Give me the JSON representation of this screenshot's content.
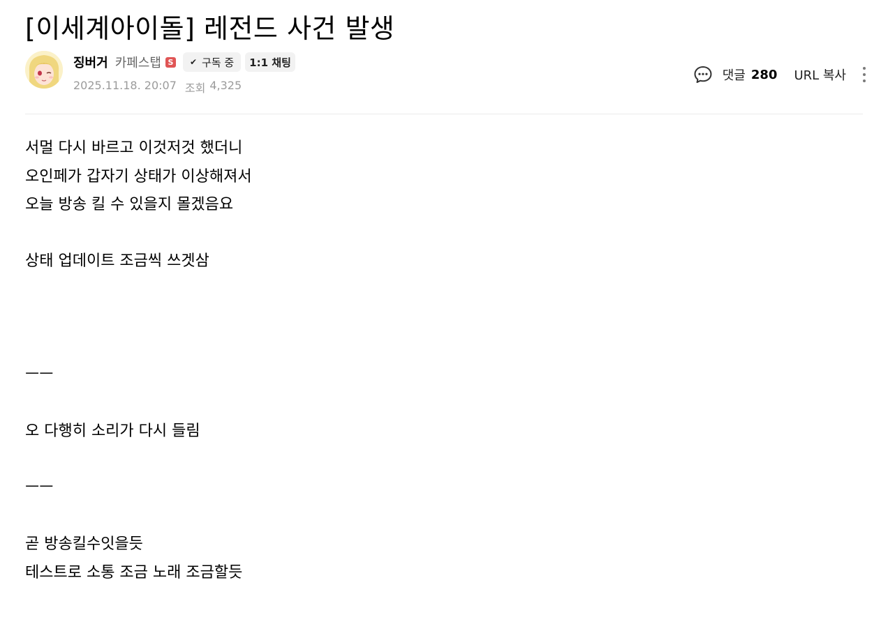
{
  "post": {
    "title": "[이세계아이돌] 레전드 사건 발생",
    "author": {
      "name": "징버거",
      "level": "카페스탭",
      "level_badge": "S",
      "subscribe_label": "구독 중",
      "chat_label": "1:1 채팅"
    },
    "date": "2025.11.18. 20:07",
    "views_label": "조회",
    "views_count": "4,325"
  },
  "tools": {
    "comment_label": "댓글",
    "comment_count": "280",
    "url_copy_label": "URL 복사"
  },
  "body_lines": [
    "서멀 다시 바르고 이것저것 했더니",
    "오인페가 갑자기 상태가 이상해져서",
    "오늘 방송 킬 수 있을지 몰겠음요",
    "",
    "상태 업데이트 조금씩 쓰겟삼",
    "",
    "",
    "",
    "ㅡㅡ",
    "",
    "오 다행히 소리가 다시 들림",
    "",
    "ㅡㅡ",
    "",
    "곧 방송킬수잇을듯",
    "테스트로 소통 조금 노래 조금할듯"
  ],
  "colors": {
    "badge": "#e05555",
    "chip_bg": "#f2f2f2",
    "meta_text": "#9b9b9b",
    "divider": "#ebebeb"
  }
}
